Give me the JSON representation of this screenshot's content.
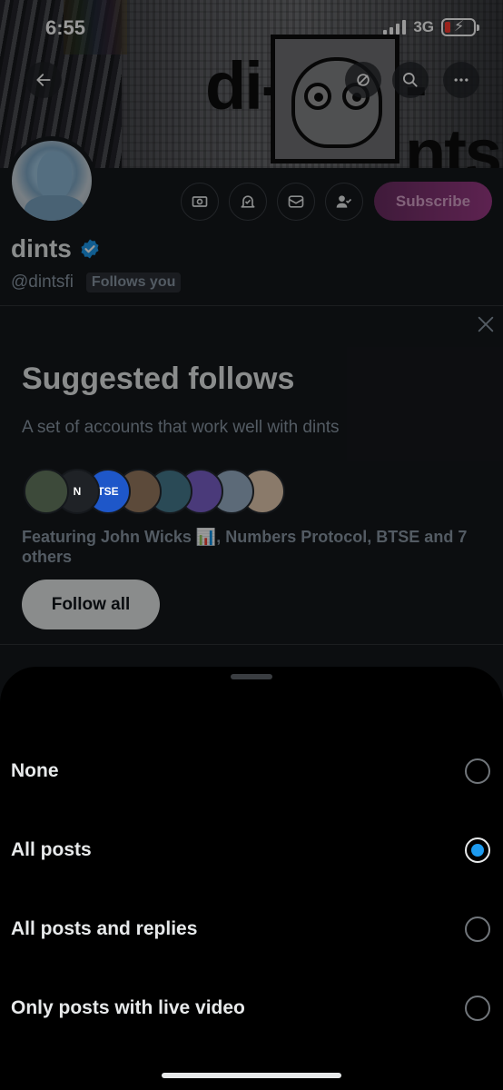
{
  "status_bar": {
    "time": "6:55",
    "network": "3G"
  },
  "banner": {
    "logo_left": "di--",
    "logo_right": "-nts"
  },
  "profile": {
    "display_name": "dints",
    "handle": "@dintsfi",
    "follows_you": "Follows you",
    "subscribe_label": "Subscribe"
  },
  "suggested": {
    "title": "Suggested follows",
    "subtitle": "A set of accounts that work well with dints",
    "avatars": [
      {
        "label": "",
        "color": "#3d4a3a"
      },
      {
        "label": "N",
        "color": "#1f2226"
      },
      {
        "label": "TSE",
        "color": "#1e57c9"
      },
      {
        "label": "",
        "color": "#5c4a3a"
      },
      {
        "label": "",
        "color": "#2a4a56"
      },
      {
        "label": "",
        "color": "#4a3a7a"
      },
      {
        "label": "",
        "color": "#5c6a78"
      },
      {
        "label": "",
        "color": "#8a7a6a"
      }
    ],
    "featuring_text": "Featuring John Wicks 📊, Numbers Protocol, BTSE and 7 others",
    "follow_all_label": "Follow all"
  },
  "sheet": {
    "options": [
      {
        "label": "None",
        "selected": false
      },
      {
        "label": "All posts",
        "selected": true
      },
      {
        "label": "All posts and replies",
        "selected": false
      },
      {
        "label": "Only posts with live video",
        "selected": false
      }
    ]
  },
  "colors": {
    "accent": "#1d9bf0",
    "subscribe": "#9b3a86",
    "sheet_bg": "#000000"
  }
}
